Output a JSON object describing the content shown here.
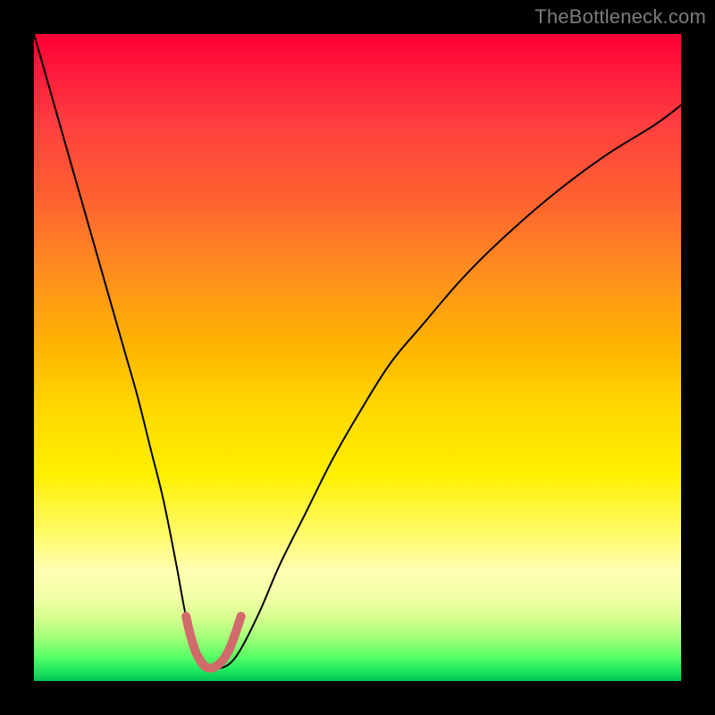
{
  "watermark": "TheBottleneck.com",
  "chart_data": {
    "type": "line",
    "title": "",
    "xlabel": "",
    "ylabel": "",
    "xlim": [
      0,
      100
    ],
    "ylim": [
      0,
      100
    ],
    "grid": false,
    "legend": false,
    "background_gradient": {
      "orientation": "vertical",
      "stops": [
        {
          "pos": 0,
          "color": "#ff0033"
        },
        {
          "pos": 25,
          "color": "#ff6030"
        },
        {
          "pos": 48,
          "color": "#ffb400"
        },
        {
          "pos": 68,
          "color": "#fff000"
        },
        {
          "pos": 85,
          "color": "#ffffb0"
        },
        {
          "pos": 96,
          "color": "#5fff66"
        },
        {
          "pos": 100,
          "color": "#00c455"
        }
      ]
    },
    "series": [
      {
        "name": "bottleneck-curve",
        "stroke": "#000000",
        "stroke_width": 2,
        "x": [
          0,
          2,
          4,
          6,
          8,
          10,
          12,
          14,
          16,
          18,
          20,
          22,
          23.5,
          25,
          26.5,
          28,
          30,
          32,
          35,
          38,
          42,
          46,
          50,
          55,
          60,
          66,
          72,
          80,
          88,
          96,
          100
        ],
        "y": [
          100,
          93,
          86,
          79,
          72,
          65,
          58,
          51,
          44,
          36,
          28,
          18,
          10,
          5,
          2.5,
          2,
          2.5,
          5,
          11,
          18,
          26,
          34,
          41,
          49,
          55,
          62,
          68,
          75,
          81,
          86,
          89
        ]
      },
      {
        "name": "highlight-dip",
        "stroke": "#d16a6a",
        "stroke_width": 10,
        "x": [
          23.5,
          24.2,
          25,
          25.8,
          26.5,
          27.3,
          28,
          29,
          30,
          31,
          32
        ],
        "y": [
          10,
          7,
          4.5,
          3,
          2.2,
          2,
          2.2,
          3,
          4.5,
          7,
          10
        ]
      }
    ],
    "notes": "Axes carry no tick labels in the source image; values are normalized to a 0–100 coordinate space read off the plot area. y=0 is the bottom edge (green), y=100 the top edge (red). The curve minimum (the 'sweet spot') sits near x≈27, y≈2."
  }
}
